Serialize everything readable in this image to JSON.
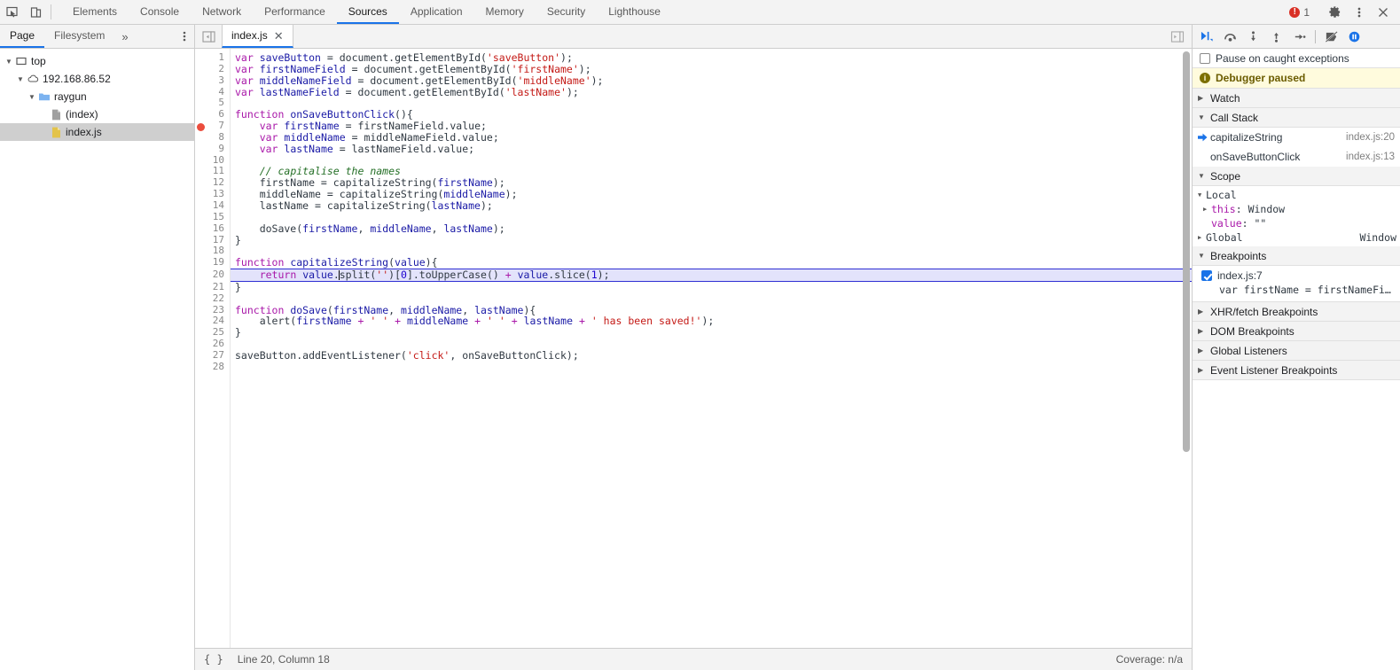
{
  "toolbar": {
    "inspect_icon": "inspect-cursor-icon",
    "device_icon": "device-toolbar-icon",
    "tabs": [
      {
        "label": "Elements",
        "active": false
      },
      {
        "label": "Console",
        "active": false
      },
      {
        "label": "Network",
        "active": false
      },
      {
        "label": "Performance",
        "active": false
      },
      {
        "label": "Sources",
        "active": true
      },
      {
        "label": "Application",
        "active": false
      },
      {
        "label": "Memory",
        "active": false
      },
      {
        "label": "Security",
        "active": false
      },
      {
        "label": "Lighthouse",
        "active": false
      }
    ],
    "error_count": "1",
    "settings_icon": "gear-icon",
    "more_icon": "kebab-menu-icon",
    "close_icon": "close-icon"
  },
  "navigator": {
    "tabs": [
      {
        "label": "Page",
        "active": true
      },
      {
        "label": "Filesystem",
        "active": false
      }
    ],
    "overflow_label": "»",
    "tree": [
      {
        "label": "top",
        "depth": 0,
        "twisty": "▼",
        "icon": "frame-icon",
        "selected": false
      },
      {
        "label": "192.168.86.52",
        "depth": 1,
        "twisty": "▼",
        "icon": "cloud-icon",
        "selected": false
      },
      {
        "label": "raygun",
        "depth": 2,
        "twisty": "▼",
        "icon": "folder-icon",
        "selected": false
      },
      {
        "label": "(index)",
        "depth": 3,
        "twisty": "",
        "icon": "document-icon",
        "selected": false
      },
      {
        "label": "index.js",
        "depth": 3,
        "twisty": "",
        "icon": "js-file-icon",
        "selected": true
      }
    ]
  },
  "editor": {
    "collapse_icon": "collapse-sidebar-icon",
    "expand_icon": "expand-sidebar-icon",
    "tab_label": "index.js",
    "close_label": "✕",
    "execution_line": 20,
    "breakpoint_lines": [
      7
    ],
    "total_lines": 28,
    "lines": [
      {
        "n": 1,
        "tokens": [
          {
            "t": "kw",
            "s": "var"
          },
          {
            "t": "pl",
            "s": " "
          },
          {
            "t": "var",
            "s": "saveButton"
          },
          {
            "t": "pl",
            "s": " = "
          },
          {
            "t": "pl",
            "s": "document"
          },
          {
            "t": "pl",
            "s": ".getElementById("
          },
          {
            "t": "str",
            "s": "'saveButton'"
          },
          {
            "t": "pl",
            "s": ");"
          }
        ]
      },
      {
        "n": 2,
        "tokens": [
          {
            "t": "kw",
            "s": "var"
          },
          {
            "t": "pl",
            "s": " "
          },
          {
            "t": "var",
            "s": "firstNameField"
          },
          {
            "t": "pl",
            "s": " = "
          },
          {
            "t": "pl",
            "s": "document"
          },
          {
            "t": "pl",
            "s": ".getElementById("
          },
          {
            "t": "str",
            "s": "'firstName'"
          },
          {
            "t": "pl",
            "s": ");"
          }
        ]
      },
      {
        "n": 3,
        "tokens": [
          {
            "t": "kw",
            "s": "var"
          },
          {
            "t": "pl",
            "s": " "
          },
          {
            "t": "var",
            "s": "middleNameField"
          },
          {
            "t": "pl",
            "s": " = "
          },
          {
            "t": "pl",
            "s": "document"
          },
          {
            "t": "pl",
            "s": ".getElementById("
          },
          {
            "t": "str",
            "s": "'middleName'"
          },
          {
            "t": "pl",
            "s": ");"
          }
        ]
      },
      {
        "n": 4,
        "tokens": [
          {
            "t": "kw",
            "s": "var"
          },
          {
            "t": "pl",
            "s": " "
          },
          {
            "t": "var",
            "s": "lastNameField"
          },
          {
            "t": "pl",
            "s": " = "
          },
          {
            "t": "pl",
            "s": "document"
          },
          {
            "t": "pl",
            "s": ".getElementById("
          },
          {
            "t": "str",
            "s": "'lastName'"
          },
          {
            "t": "pl",
            "s": ");"
          }
        ]
      },
      {
        "n": 5,
        "tokens": []
      },
      {
        "n": 6,
        "tokens": [
          {
            "t": "kw",
            "s": "function"
          },
          {
            "t": "pl",
            "s": " "
          },
          {
            "t": "var",
            "s": "onSaveButtonClick"
          },
          {
            "t": "pl",
            "s": "(){"
          }
        ]
      },
      {
        "n": 7,
        "tokens": [
          {
            "t": "pl",
            "s": "    "
          },
          {
            "t": "kw",
            "s": "var"
          },
          {
            "t": "pl",
            "s": " "
          },
          {
            "t": "var",
            "s": "firstName"
          },
          {
            "t": "pl",
            "s": " = "
          },
          {
            "t": "pl",
            "s": "firstNameField.value;"
          }
        ]
      },
      {
        "n": 8,
        "tokens": [
          {
            "t": "pl",
            "s": "    "
          },
          {
            "t": "kw",
            "s": "var"
          },
          {
            "t": "pl",
            "s": " "
          },
          {
            "t": "var",
            "s": "middleName"
          },
          {
            "t": "pl",
            "s": " = "
          },
          {
            "t": "pl",
            "s": "middleNameField.value;"
          }
        ]
      },
      {
        "n": 9,
        "tokens": [
          {
            "t": "pl",
            "s": "    "
          },
          {
            "t": "kw",
            "s": "var"
          },
          {
            "t": "pl",
            "s": " "
          },
          {
            "t": "var",
            "s": "lastName"
          },
          {
            "t": "pl",
            "s": " = "
          },
          {
            "t": "pl",
            "s": "lastNameField.value;"
          }
        ]
      },
      {
        "n": 10,
        "tokens": []
      },
      {
        "n": 11,
        "tokens": [
          {
            "t": "pl",
            "s": "    "
          },
          {
            "t": "com",
            "s": "// capitalise the names"
          }
        ]
      },
      {
        "n": 12,
        "tokens": [
          {
            "t": "pl",
            "s": "    firstName = capitalizeString("
          },
          {
            "t": "var",
            "s": "firstName"
          },
          {
            "t": "pl",
            "s": ");"
          }
        ]
      },
      {
        "n": 13,
        "tokens": [
          {
            "t": "pl",
            "s": "    middleName = capitalizeString("
          },
          {
            "t": "var",
            "s": "middleName"
          },
          {
            "t": "pl",
            "s": ");"
          }
        ]
      },
      {
        "n": 14,
        "tokens": [
          {
            "t": "pl",
            "s": "    lastName = capitalizeString("
          },
          {
            "t": "var",
            "s": "lastName"
          },
          {
            "t": "pl",
            "s": ");"
          }
        ]
      },
      {
        "n": 15,
        "tokens": []
      },
      {
        "n": 16,
        "tokens": [
          {
            "t": "pl",
            "s": "    doSave("
          },
          {
            "t": "var",
            "s": "firstName"
          },
          {
            "t": "pl",
            "s": ", "
          },
          {
            "t": "var",
            "s": "middleName"
          },
          {
            "t": "pl",
            "s": ", "
          },
          {
            "t": "var",
            "s": "lastName"
          },
          {
            "t": "pl",
            "s": ");"
          }
        ]
      },
      {
        "n": 17,
        "tokens": [
          {
            "t": "pl",
            "s": "}"
          }
        ]
      },
      {
        "n": 18,
        "tokens": []
      },
      {
        "n": 19,
        "tokens": [
          {
            "t": "kw",
            "s": "function"
          },
          {
            "t": "pl",
            "s": " "
          },
          {
            "t": "var",
            "s": "capitalizeString"
          },
          {
            "t": "pl",
            "s": "("
          },
          {
            "t": "var",
            "s": "value"
          },
          {
            "t": "pl",
            "s": "){"
          }
        ]
      },
      {
        "n": 20,
        "tokens": [
          {
            "t": "pl",
            "s": "    "
          },
          {
            "t": "kw",
            "s": "return"
          },
          {
            "t": "pl",
            "s": " "
          },
          {
            "t": "var",
            "s": "value"
          },
          {
            "t": "pl",
            "s": "."
          },
          {
            "t": "caret",
            "s": ""
          },
          {
            "t": "pl",
            "s": "split("
          },
          {
            "t": "str",
            "s": "''"
          },
          {
            "t": "pl",
            "s": ")["
          },
          {
            "t": "num",
            "s": "0"
          },
          {
            "t": "pl",
            "s": "].toUpperCase() "
          },
          {
            "t": "kw",
            "s": "+"
          },
          {
            "t": "pl",
            "s": " "
          },
          {
            "t": "var",
            "s": "value"
          },
          {
            "t": "pl",
            "s": ".slice("
          },
          {
            "t": "num",
            "s": "1"
          },
          {
            "t": "pl",
            "s": ");"
          }
        ]
      },
      {
        "n": 21,
        "tokens": [
          {
            "t": "pl",
            "s": "}"
          }
        ]
      },
      {
        "n": 22,
        "tokens": []
      },
      {
        "n": 23,
        "tokens": [
          {
            "t": "kw",
            "s": "function"
          },
          {
            "t": "pl",
            "s": " "
          },
          {
            "t": "var",
            "s": "doSave"
          },
          {
            "t": "pl",
            "s": "("
          },
          {
            "t": "var",
            "s": "firstName"
          },
          {
            "t": "pl",
            "s": ", "
          },
          {
            "t": "var",
            "s": "middleName"
          },
          {
            "t": "pl",
            "s": ", "
          },
          {
            "t": "var",
            "s": "lastName"
          },
          {
            "t": "pl",
            "s": "){"
          }
        ]
      },
      {
        "n": 24,
        "tokens": [
          {
            "t": "pl",
            "s": "    alert("
          },
          {
            "t": "var",
            "s": "firstName"
          },
          {
            "t": "pl",
            "s": " "
          },
          {
            "t": "kw",
            "s": "+"
          },
          {
            "t": "pl",
            "s": " "
          },
          {
            "t": "str",
            "s": "' '"
          },
          {
            "t": "pl",
            "s": " "
          },
          {
            "t": "kw",
            "s": "+"
          },
          {
            "t": "pl",
            "s": " "
          },
          {
            "t": "var",
            "s": "middleName"
          },
          {
            "t": "pl",
            "s": " "
          },
          {
            "t": "kw",
            "s": "+"
          },
          {
            "t": "pl",
            "s": " "
          },
          {
            "t": "str",
            "s": "' '"
          },
          {
            "t": "pl",
            "s": " "
          },
          {
            "t": "kw",
            "s": "+"
          },
          {
            "t": "pl",
            "s": " "
          },
          {
            "t": "var",
            "s": "lastName"
          },
          {
            "t": "pl",
            "s": " "
          },
          {
            "t": "kw",
            "s": "+"
          },
          {
            "t": "pl",
            "s": " "
          },
          {
            "t": "str",
            "s": "' has been saved!'"
          },
          {
            "t": "pl",
            "s": ");"
          }
        ]
      },
      {
        "n": 25,
        "tokens": [
          {
            "t": "pl",
            "s": "}"
          }
        ]
      },
      {
        "n": 26,
        "tokens": []
      },
      {
        "n": 27,
        "tokens": [
          {
            "t": "pl",
            "s": "saveButton.addEventListener("
          },
          {
            "t": "str",
            "s": "'click'"
          },
          {
            "t": "pl",
            "s": ", onSaveButtonClick);"
          }
        ]
      },
      {
        "n": 28,
        "tokens": []
      }
    ]
  },
  "status_bar": {
    "pretty_print_label": "{ }",
    "cursor_position": "Line 20, Column 18",
    "coverage": "Coverage: n/a"
  },
  "debugger": {
    "buttons": [
      {
        "name": "resume-script-execution",
        "icon": "resume-icon"
      },
      {
        "name": "step-over-next-function-call",
        "icon": "step-over-icon"
      },
      {
        "name": "step-into-next-function-call",
        "icon": "step-into-icon"
      },
      {
        "name": "step-out-of-current-function",
        "icon": "step-out-icon"
      },
      {
        "name": "step",
        "icon": "step-icon"
      },
      {
        "name": "deactivate-breakpoints",
        "icon": "deactivate-breakpoints-icon"
      },
      {
        "name": "pause-on-exceptions",
        "icon": "pause-on-exceptions-icon"
      }
    ],
    "pause_on_caught_label": "Pause on caught exceptions",
    "pause_on_caught_checked": false,
    "paused_banner": "Debugger paused",
    "sections": {
      "watch": {
        "label": "Watch",
        "expanded": false
      },
      "call_stack": {
        "label": "Call Stack",
        "expanded": true
      },
      "scope": {
        "label": "Scope",
        "expanded": true
      },
      "breakpoints": {
        "label": "Breakpoints",
        "expanded": true
      },
      "xhr": {
        "label": "XHR/fetch Breakpoints",
        "expanded": false
      },
      "dom": {
        "label": "DOM Breakpoints",
        "expanded": false
      },
      "global_listeners": {
        "label": "Global Listeners",
        "expanded": false
      },
      "event_listener": {
        "label": "Event Listener Breakpoints",
        "expanded": false
      }
    },
    "call_stack": [
      {
        "fn": "capitalizeString",
        "loc": "index.js:20",
        "current": true
      },
      {
        "fn": "onSaveButtonClick",
        "loc": "index.js:13",
        "current": false
      }
    ],
    "scope": {
      "local_label": "Local",
      "entries": [
        {
          "name": "this",
          "value": "Window",
          "expandable": true
        },
        {
          "name": "value",
          "value": "\"\"",
          "expandable": false
        }
      ],
      "global_label": "Global",
      "global_value": "Window"
    },
    "breakpoints": [
      {
        "location": "index.js:7",
        "checked": true,
        "code": "var firstName = firstNameFi…"
      }
    ]
  },
  "colors": {
    "accent": "#1a73e8",
    "error": "#d93025",
    "breakpoint": "#eb4d3d",
    "exec_line_bg": "#e3e3fb",
    "paused_banner_bg": "#fffbdd"
  }
}
